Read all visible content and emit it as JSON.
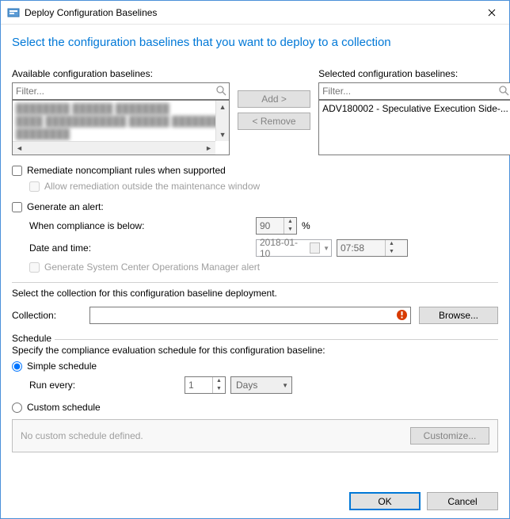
{
  "window": {
    "title": "Deploy Configuration Baselines"
  },
  "headline": "Select the configuration baselines that you want to deploy to a collection",
  "available": {
    "label": "Available configuration baselines:",
    "filter_placeholder": "Filter...",
    "items": [
      "████████ ██████ ████████",
      "████ ████████████ ██████ ████████",
      "████████"
    ]
  },
  "selected": {
    "label": "Selected configuration baselines:",
    "filter_placeholder": "Filter...",
    "items": [
      "ADV180002 - Speculative Execution Side-..."
    ]
  },
  "buttons": {
    "add": "Add >",
    "remove": "< Remove",
    "browse": "Browse...",
    "customize": "Customize...",
    "ok": "OK",
    "cancel": "Cancel"
  },
  "options": {
    "remediate": "Remediate noncompliant rules when supported",
    "allow_outside_window": "Allow remediation outside the maintenance window",
    "generate_alert": "Generate an alert:",
    "compliance_below_label": "When compliance is below:",
    "compliance_below_value": "90",
    "compliance_unit": "%",
    "datetime_label": "Date and time:",
    "date_value": "2018-01-10",
    "time_value": "07:58",
    "scom_alert": "Generate System Center Operations Manager alert"
  },
  "collection": {
    "section_text": "Select the collection for this configuration baseline deployment.",
    "label": "Collection:",
    "value": ""
  },
  "schedule": {
    "legend": "Schedule",
    "text": "Specify the compliance evaluation schedule for this configuration baseline:",
    "simple_label": "Simple schedule",
    "run_every_label": "Run every:",
    "run_every_value": "1",
    "unit": "Days",
    "custom_label": "Custom schedule",
    "custom_none": "No custom schedule defined."
  }
}
